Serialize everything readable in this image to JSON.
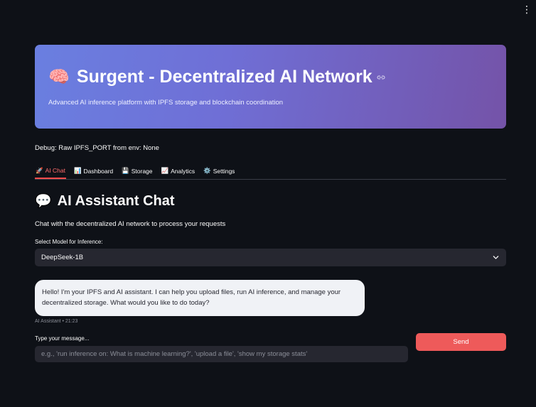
{
  "header": {
    "menu_icon": "kebab-menu-icon",
    "title_emoji": "🧠",
    "title": "Surgent - Decentralized AI Network",
    "subtitle": "Advanced AI inference platform with IPFS storage and blockchain coordination"
  },
  "debug_text": "Debug: Raw IPFS_PORT from env: None",
  "tabs": [
    {
      "icon": "🚀",
      "label": "AI Chat",
      "active": true
    },
    {
      "icon": "📊",
      "label": "Dashboard",
      "active": false
    },
    {
      "icon": "💾",
      "label": "Storage",
      "active": false
    },
    {
      "icon": "📈",
      "label": "Analytics",
      "active": false
    },
    {
      "icon": "⚙️",
      "label": "Settings",
      "active": false
    }
  ],
  "chat": {
    "heading_emoji": "💬",
    "heading": "AI Assistant Chat",
    "description": "Chat with the decentralized AI network to process your requests",
    "model_label": "Select Model for Inference:",
    "model_value": "DeepSeek-1B",
    "assistant_message": "Hello! I'm your IPFS and AI assistant. I can help you upload files, run AI inference, and manage your decentralized storage. What would you like to do today?",
    "message_meta": "AI Assistant • 21:23",
    "input_label": "Type your message...",
    "input_placeholder": "e.g., 'run inference on: What is machine learning?', 'upload a file', 'show my storage stats'",
    "send_label": "Send"
  },
  "colors": {
    "background": "#0e1117",
    "accent": "#ff4b4b",
    "send_button": "#ee5a5a",
    "hero_gradient_start": "#6a7fe0",
    "hero_gradient_end": "#7453a8"
  }
}
